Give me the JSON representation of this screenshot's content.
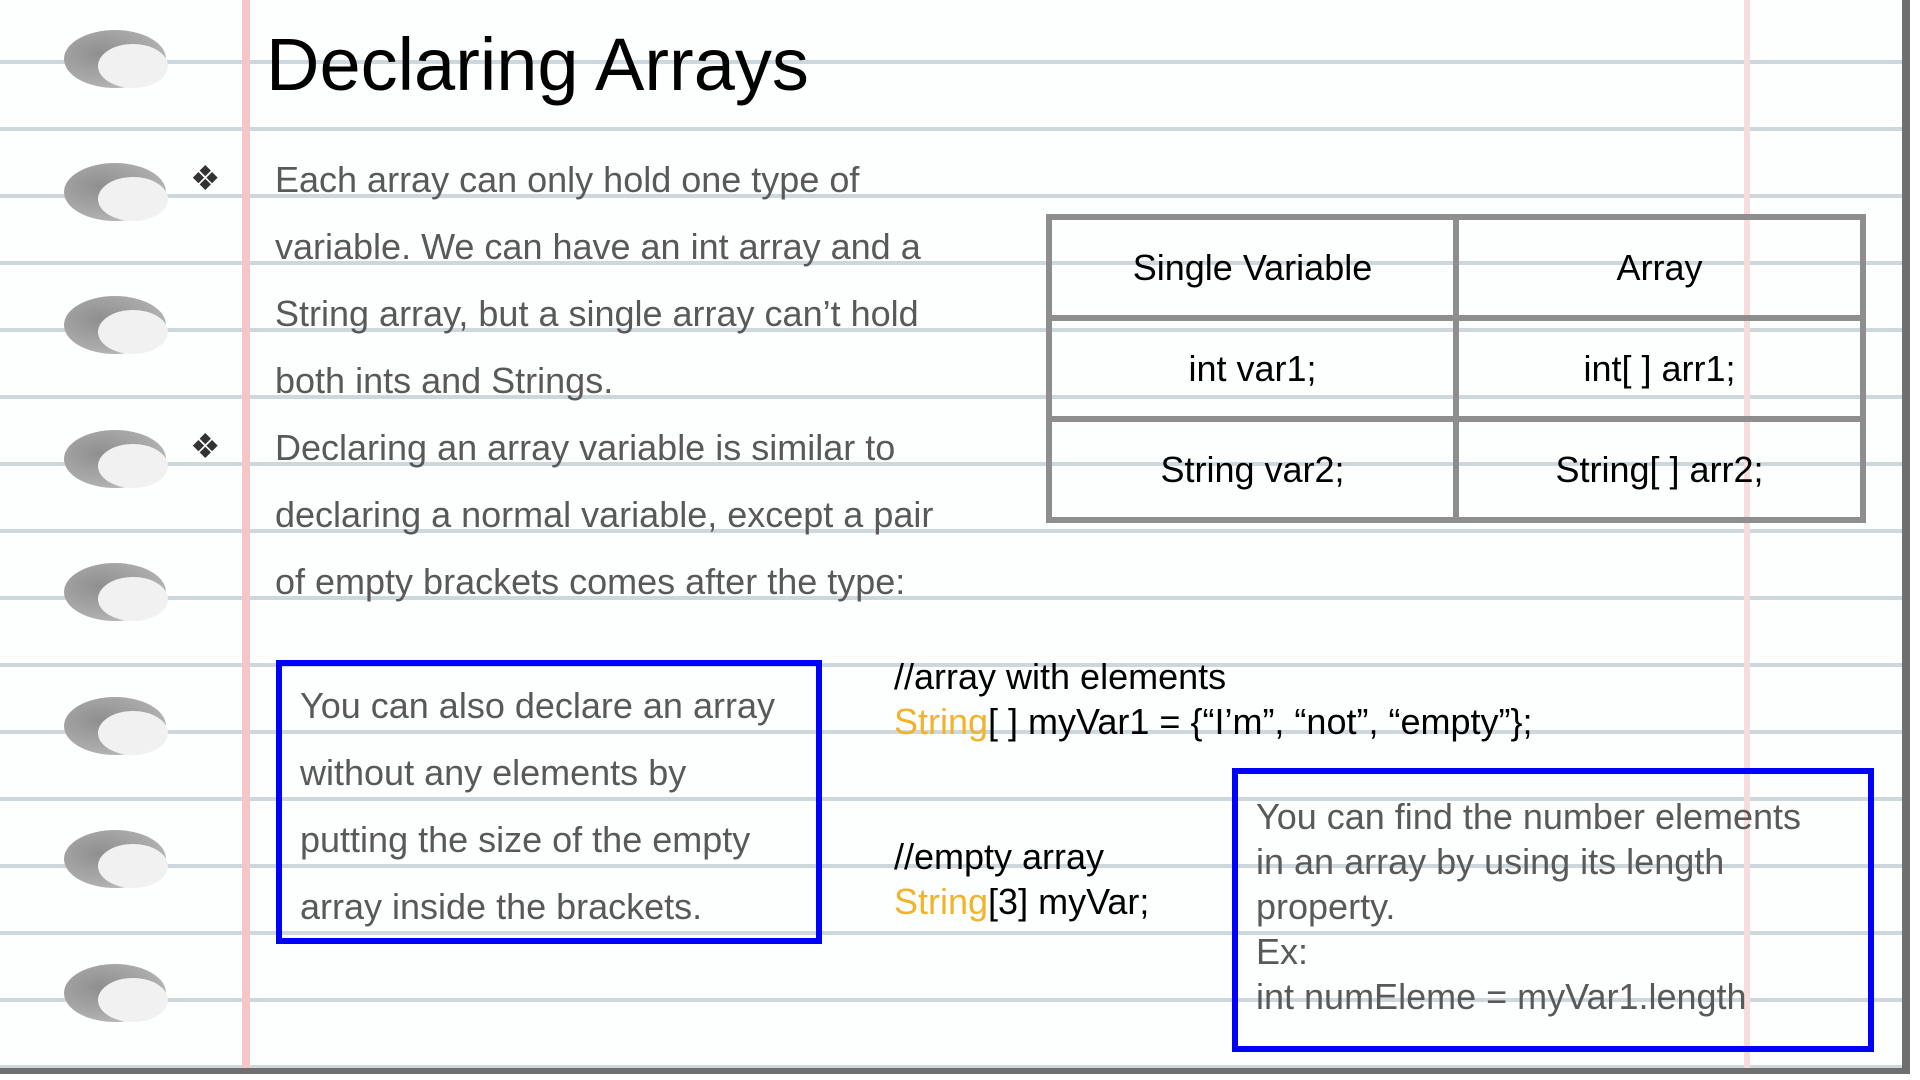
{
  "slide": {
    "title": "Declaring Arrays",
    "bullet_glyph": "❖",
    "bullets": [
      "Each array can only hold one type of variable. We can have an int array and a String array, but a single array can’t hold both ints and Strings.",
      "Declaring an array variable is similar to declaring a normal variable, except a pair of empty brackets comes after the type:"
    ]
  },
  "table": {
    "header": [
      "Single Variable",
      "Array"
    ],
    "rows": [
      [
        "int var1;",
        "int[ ] arr1;"
      ],
      [
        "String var2;",
        "String[ ] arr2;"
      ]
    ]
  },
  "code1": {
    "comment": "//array with elements",
    "keyword": "String",
    "rest": "[ ] myVar1 = {“I’m”, “not”, “empty”};"
  },
  "code2": {
    "comment": "//empty array",
    "keyword": "String",
    "rest": "[3] myVar;"
  },
  "box1": {
    "text": "You can also declare an array without any elements by putting the size of the empty array inside the brackets."
  },
  "box2": {
    "lines": [
      "You can find the number elements",
      "in an array by using its length",
      "property.",
      "Ex:",
      "int numEleme = myVar1.length"
    ]
  },
  "colors": {
    "keyword": "#f1b32a",
    "box_border": "#0000ff",
    "body_text": "#595959"
  }
}
